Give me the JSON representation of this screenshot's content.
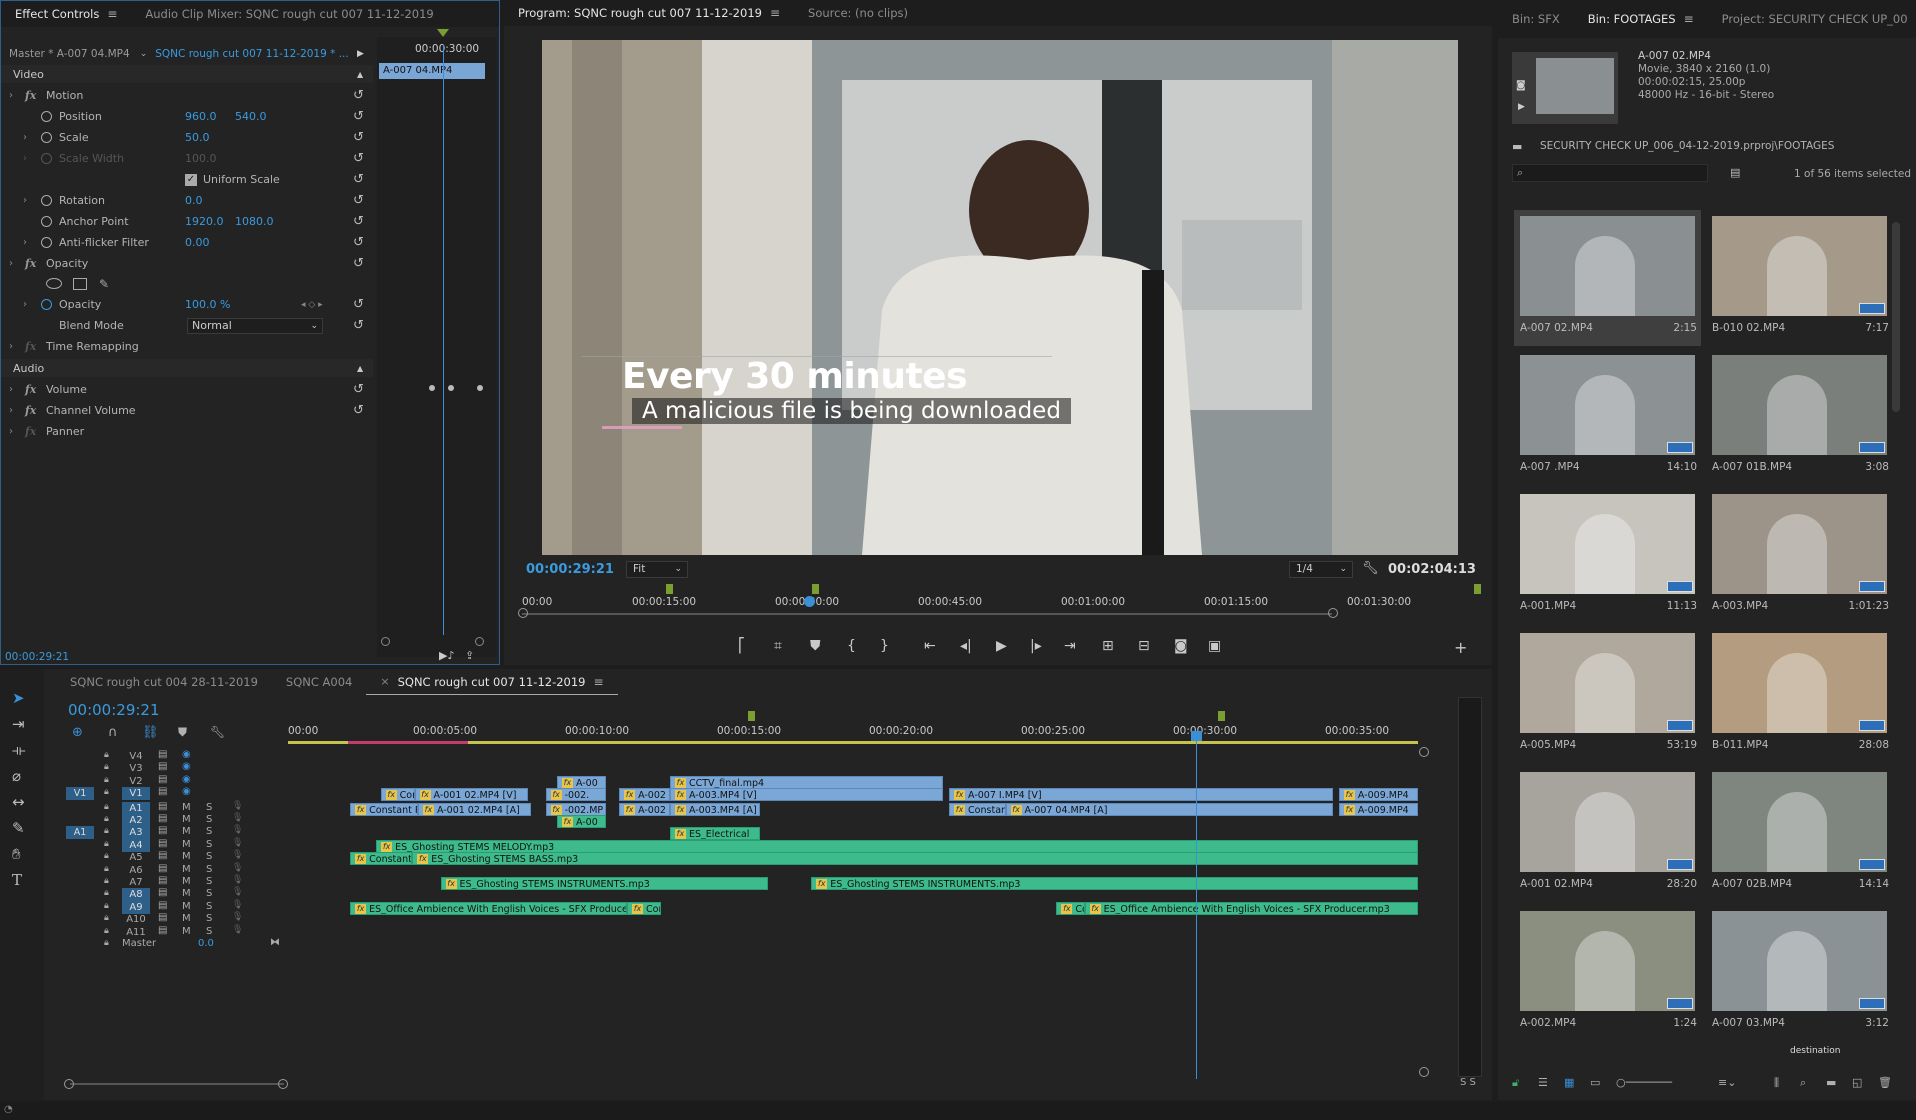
{
  "effect_controls": {
    "tabs": [
      {
        "label": "Effect Controls",
        "active": true
      },
      {
        "label": "Audio Clip Mixer: SQNC rough cut  007 11-12-2019",
        "active": false
      }
    ],
    "master_label": "Master * A-007 04.MP4",
    "sequence_label": "SQNC rough cut  007 11-12-2019  * ...",
    "timecode_ruler": "00:00:30:00",
    "clip_label": "A-007 04.MP4",
    "sections": {
      "video": "Video",
      "audio": "Audio"
    },
    "rows": [
      {
        "name": "Motion",
        "kind": "fx"
      },
      {
        "name": "Position",
        "v1": "960.0",
        "v2": "540.0"
      },
      {
        "name": "Scale",
        "v1": "50.0"
      },
      {
        "name": "Scale Width",
        "v1": "100.0"
      },
      {
        "name": "Uniform Scale"
      },
      {
        "name": "Rotation",
        "v1": "0.0"
      },
      {
        "name": "Anchor Point",
        "v1": "1920.0",
        "v2": "1080.0"
      },
      {
        "name": "Anti-flicker Filter",
        "v1": "0.00"
      },
      {
        "name": "Opacity",
        "kind": "fx"
      },
      {
        "name": "Opacity",
        "v1": "100.0 %"
      },
      {
        "name": "Blend Mode",
        "v1": "Normal"
      },
      {
        "name": "Time Remapping",
        "kind": "fx"
      },
      {
        "name": "Volume",
        "kind": "fx"
      },
      {
        "name": "Channel Volume",
        "kind": "fx"
      },
      {
        "name": "Panner",
        "kind": "fx"
      }
    ],
    "current_time": "00:00:29:21"
  },
  "program_monitor": {
    "tabs": [
      {
        "label": "Program: SQNC rough cut  007 11-12-2019",
        "active": true
      },
      {
        "label": "Source: (no clips)",
        "active": false
      }
    ],
    "overlay_title": "Every 30 minutes",
    "overlay_subtitle": "A malicious file is being downloaded",
    "current_time": "00:00:29:21",
    "fit": "Fit",
    "resolution": "1/4",
    "duration": "00:02:04:13",
    "ruler": [
      "00:00",
      "00:00:15:00",
      "00:00:30:00",
      "00:00:45:00",
      "00:01:00:00",
      "00:01:15:00",
      "00:01:30:00"
    ]
  },
  "project": {
    "tabs": [
      {
        "label": "Bin: SFX",
        "active": false
      },
      {
        "label": "Bin: FOOTAGES",
        "active": true
      },
      {
        "label": "Project: SECURITY CHECK UP_00",
        "active": false
      }
    ],
    "preview": {
      "name": "A-007 02.MP4",
      "line1": "Movie, 3840 x 2160 (1.0)",
      "line2": "00:00:02:15, 25.00p",
      "line3": "48000 Hz - 16-bit - Stereo"
    },
    "path": "SECURITY CHECK UP_006_04-12-2019.prproj\\FOOTAGES",
    "selected_count": "1 of 56 items selected",
    "items": [
      {
        "name": "A-007 02.MP4",
        "dur": "2:15",
        "color": "#8a8f92"
      },
      {
        "name": "B-010 02.MP4",
        "dur": "7:17",
        "color": "#a59a8a"
      },
      {
        "name": "A-007 .MP4",
        "dur": "14:10",
        "color": "#8c9194"
      },
      {
        "name": "A-007 01B.MP4",
        "dur": "3:08",
        "color": "#7a7f7c"
      },
      {
        "name": "A-001.MP4",
        "dur": "11:13",
        "color": "#c7c3bd"
      },
      {
        "name": "A-003.MP4",
        "dur": "1:01:23",
        "color": "#9c9389"
      },
      {
        "name": "A-005.MP4",
        "dur": "53:19",
        "color": "#b0a89c"
      },
      {
        "name": "B-011.MP4",
        "dur": "28:08",
        "color": "#b39c80"
      },
      {
        "name": "A-001 02.MP4",
        "dur": "28:20",
        "color": "#a7a39d"
      },
      {
        "name": "A-007 02B.MP4",
        "dur": "14:14",
        "color": "#7f8680"
      },
      {
        "name": "A-002.MP4",
        "dur": "1:24",
        "color": "#8a8f80"
      },
      {
        "name": "A-007 03.MP4",
        "dur": "3:12",
        "color": "#8a9296"
      }
    ],
    "partial_label": "destination"
  },
  "timeline": {
    "tabs": [
      {
        "label": "SQNC rough cut  004 28-11-2019",
        "active": false
      },
      {
        "label": "SQNC A004",
        "active": false
      },
      {
        "label": "SQNC rough cut  007 11-12-2019",
        "active": true
      }
    ],
    "current_time": "00:00:29:21",
    "ruler": [
      "00:00",
      "00:00:05:00",
      "00:00:10:00",
      "00:00:15:00",
      "00:00:20:00",
      "00:00:25:00",
      "00:00:30:00",
      "00:00:35:00"
    ],
    "video_tracks": [
      "V4",
      "V3",
      "V2",
      "V1"
    ],
    "audio_tracks": [
      "A1",
      "A2",
      "A3",
      "A4",
      "A5",
      "A6",
      "A7",
      "A8",
      "A9",
      "A10",
      "A11"
    ],
    "source_v": "V1",
    "source_a": "A1",
    "master_label": "Master",
    "master_value": "0.0",
    "mute": "M",
    "solo": "S",
    "clips_video": [
      {
        "label": "A-00",
        "track": 2,
        "start": 0.238,
        "width": 0.043
      },
      {
        "label": "CCTV_final.mp4",
        "track": 2,
        "start": 0.338,
        "width": 0.242
      },
      {
        "label": "Const",
        "track": 3,
        "start": 0.082,
        "width": 0.03
      },
      {
        "label": "A-001 02.MP4 [V]",
        "track": 3,
        "start": 0.112,
        "width": 0.1
      },
      {
        "label": "-002.",
        "track": 3,
        "start": 0.228,
        "width": 0.053
      },
      {
        "label": "A-002",
        "track": 3,
        "start": 0.293,
        "width": 0.045
      },
      {
        "label": "A-003.MP4 [V]",
        "track": 3,
        "start": 0.338,
        "width": 0.242
      },
      {
        "label": "A-007 I.MP4 [V]",
        "track": 3,
        "start": 0.585,
        "width": 0.34
      },
      {
        "label": "A-009.MP4",
        "track": 3,
        "start": 0.93,
        "width": 0.07
      }
    ],
    "clips_audio": [
      {
        "label": "Constant Power",
        "track": 0,
        "start": 0.055,
        "width": 0.06
      },
      {
        "label": "A-001 02.MP4 [A]",
        "track": 0,
        "start": 0.115,
        "width": 0.1
      },
      {
        "label": "-002.MP",
        "track": 0,
        "start": 0.228,
        "width": 0.053
      },
      {
        "label": "A-002",
        "track": 0,
        "start": 0.293,
        "width": 0.045
      },
      {
        "label": "A-003.MP4 [A]",
        "track": 0,
        "start": 0.338,
        "width": 0.08
      },
      {
        "label": "Constant",
        "track": 0,
        "start": 0.585,
        "width": 0.05
      },
      {
        "label": "A-007 04.MP4 [A]",
        "track": 0,
        "start": 0.635,
        "width": 0.29
      },
      {
        "label": "A-009.MP4",
        "track": 0,
        "start": 0.93,
        "width": 0.07
      },
      {
        "label": "A-00",
        "track": 1,
        "start": 0.238,
        "width": 0.043
      },
      {
        "label": "ES_Electrical",
        "track": 2,
        "start": 0.338,
        "width": 0.08
      },
      {
        "label": "ES_Ghosting STEMS MELODY.mp3",
        "track": 3,
        "start": 0.078,
        "width": 0.922
      },
      {
        "label": "Constant Pow",
        "track": 4,
        "start": 0.055,
        "width": 0.055
      },
      {
        "label": "ES_Ghosting STEMS BASS.mp3",
        "track": 4,
        "start": 0.11,
        "width": 0.89
      },
      {
        "label": "ES_Ghosting STEMS INSTRUMENTS.mp3",
        "track": 6,
        "start": 0.135,
        "width": 0.29
      },
      {
        "label": "ES_Ghosting STEMS INSTRUMENTS.mp3",
        "track": 6,
        "start": 0.463,
        "width": 0.537
      },
      {
        "label": "ES_Office Ambience With English Voices - SFX Producer.mp3",
        "track": 8,
        "start": 0.055,
        "width": 0.245
      },
      {
        "label": "Const",
        "track": 8,
        "start": 0.3,
        "width": 0.03
      },
      {
        "label": "Const",
        "track": 8,
        "start": 0.68,
        "width": 0.025
      },
      {
        "label": "ES_Office Ambience With English Voices - SFX Producer.mp3",
        "track": 8,
        "start": 0.705,
        "width": 0.295
      }
    ]
  },
  "meter_labels": "S S"
}
